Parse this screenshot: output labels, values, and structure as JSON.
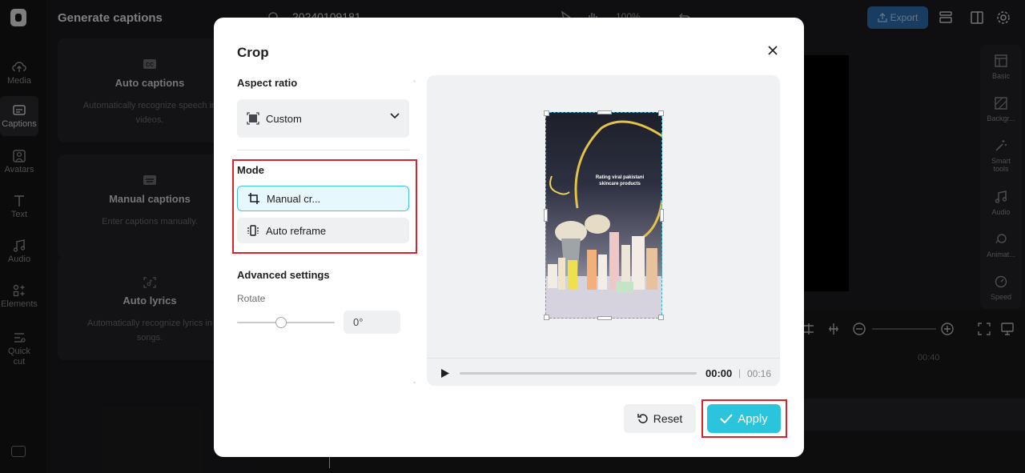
{
  "app": {
    "project_name": "20240109181",
    "export_label": "Export",
    "zoom_label": "100%"
  },
  "leftnav": {
    "items": [
      {
        "label": "Media",
        "icon": "cloud-upload-icon"
      },
      {
        "label": "Captions",
        "icon": "captions-icon"
      },
      {
        "label": "Avatars",
        "icon": "avatar-icon"
      },
      {
        "label": "Text",
        "icon": "text-icon"
      },
      {
        "label": "Audio",
        "icon": "music-note-icon"
      },
      {
        "label": "Elements",
        "icon": "elements-icon"
      },
      {
        "label": "Quick cut",
        "icon": "quick-cut-icon"
      }
    ]
  },
  "captions_panel": {
    "title": "Generate captions",
    "cards": [
      {
        "title": "Auto captions",
        "desc": "Automatically recognize speech in videos.",
        "icon": "cc-icon"
      },
      {
        "title": "Manual captions",
        "desc": "Enter captions manually.",
        "icon": "keyboard-icon"
      },
      {
        "title": "Auto lyrics",
        "desc": "Automatically recognize lyrics in songs.",
        "icon": "lyrics-scan-icon"
      }
    ]
  },
  "right_rail": {
    "items": [
      {
        "label": "Basic",
        "icon": "basic-icon"
      },
      {
        "label": "Backgr...",
        "icon": "background-icon"
      },
      {
        "label": "Smart tools",
        "icon": "magic-wand-icon"
      },
      {
        "label": "Audio",
        "icon": "music-note-icon"
      },
      {
        "label": "Animat...",
        "icon": "animation-icon"
      },
      {
        "label": "Speed",
        "icon": "speed-icon"
      }
    ]
  },
  "timeline": {
    "time_marker": "00:40"
  },
  "crop_dialog": {
    "title": "Crop",
    "aspect_ratio_label": "Aspect ratio",
    "aspect_ratio_value": "Custom",
    "mode_label": "Mode",
    "modes": [
      {
        "label": "Manual cr...",
        "selected": true
      },
      {
        "label": "Auto reframe",
        "selected": false
      }
    ],
    "advanced_label": "Advanced settings",
    "rotate_label": "Rotate",
    "rotate_value": "0°",
    "rotate_fraction": 0.45,
    "photo_caption": "Rating viral pakistani skincare products",
    "player": {
      "current": "00:00",
      "separator": "|",
      "total": "00:16",
      "progress_fraction": 0
    },
    "reset_label": "Reset",
    "apply_label": "Apply"
  },
  "colors": {
    "accent": "#2bc4dd",
    "highlight_red": "#d8232e",
    "export_blue": "#2f6fb0"
  }
}
